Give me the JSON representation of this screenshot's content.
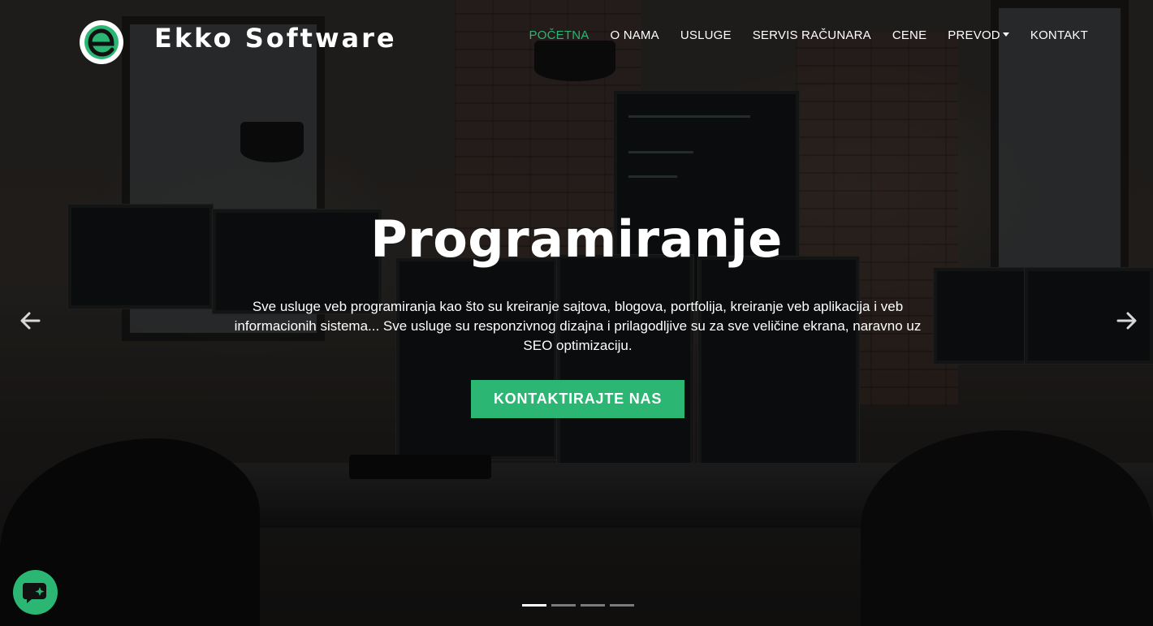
{
  "header": {
    "brand": "Ekko Software",
    "logo_icon": "ekko-e-logo",
    "nav": [
      {
        "label": "POČETNA",
        "active": true
      },
      {
        "label": "O NAMA"
      },
      {
        "label": "USLUGE"
      },
      {
        "label": "SERVIS RAČUNARA"
      },
      {
        "label": "CENE"
      },
      {
        "label": "PREVOD",
        "dropdown": true
      },
      {
        "label": "KONTAKT"
      }
    ]
  },
  "hero": {
    "title": "Programiranje",
    "description": "Sve usluge veb programiranja kao što su kreiranje sajtova, blogova, portfolija, kreiranje veb aplikacija i veb informacionih sistema... Sve usluge su responzivnog dizajna i prilagodljive su za sve veličine ekrana, naravno uz SEO optimizaciju.",
    "cta_label": "KONTAKTIRAJTE NAS",
    "prev_icon": "arrow-left-icon",
    "next_icon": "arrow-right-icon",
    "slides_total": 4,
    "active_slide": 1
  },
  "chat_widget": {
    "icon": "chat-bubble-icon"
  },
  "colors": {
    "accent": "#2bb673",
    "text": "#ffffff"
  }
}
